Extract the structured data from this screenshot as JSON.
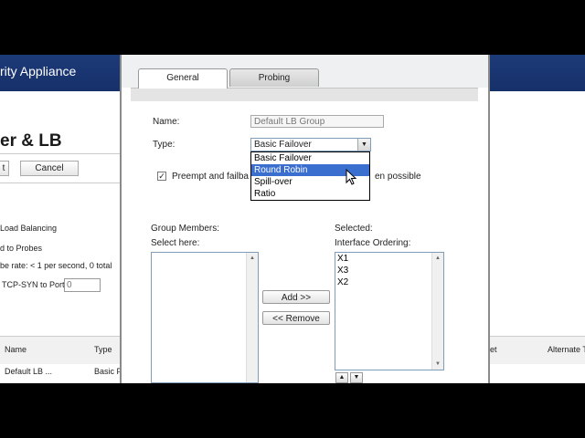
{
  "background": {
    "header_title": "rity Appliance",
    "page_title": "er & LB",
    "button_left": "t",
    "cancel_label": "Cancel",
    "load_balancing": "Load Balancing",
    "probes": "d to Probes",
    "probe_rate": "be rate: < 1 per second, 0 total",
    "tcp_syn": "TCP-SYN to Port",
    "tcp_port_value": "0",
    "table_col_name": "Name",
    "table_col_type": "Type",
    "table_col_et": "et",
    "table_col_alternate": "Alternate T",
    "row_name": "Default LB ...",
    "row_type": "Basic F"
  },
  "dialog": {
    "tabs": [
      {
        "label": "General",
        "active": true
      },
      {
        "label": "Probing",
        "active": false
      }
    ],
    "name_label": "Name:",
    "name_value": "Default LB Group",
    "type_label": "Type:",
    "type_value": "Basic Failover",
    "type_options": [
      "Basic Failover",
      "Round Robin",
      "Spill-over",
      "Ratio"
    ],
    "type_highlighted": "Round Robin",
    "preempt_label": "Preempt and failba",
    "preempt_suffix": "en possible",
    "preempt_checked": true,
    "group_members_label": "Group Members:",
    "select_here_label": "Select here:",
    "selected_label": "Selected:",
    "interface_ordering_label": "Interface Ordering:",
    "selected_items": [
      "X1",
      "X3",
      "X2"
    ],
    "add_button": "Add >>",
    "remove_button": "<< Remove"
  },
  "colors": {
    "header_blue": "#1d3a78",
    "highlight_blue": "#3a6fd0"
  }
}
